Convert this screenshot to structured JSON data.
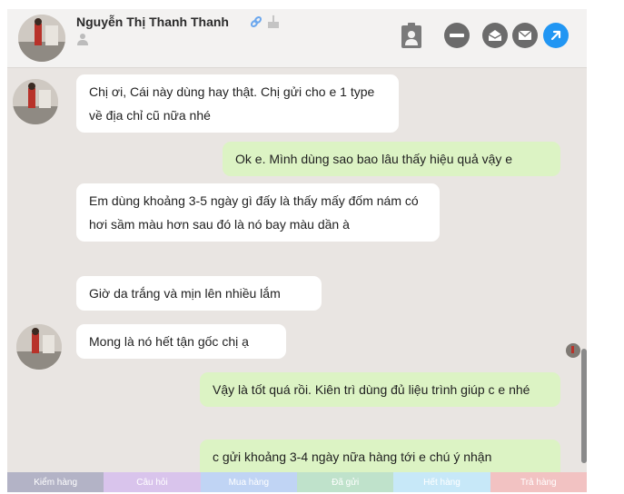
{
  "header": {
    "contact_name": "Nguyễn Thị Thanh Thanh",
    "icons": [
      "link-icon",
      "birthday-cake-icon",
      "person-icon"
    ],
    "actions": [
      "contact-card-icon",
      "minus-icon",
      "mail-open-icon",
      "mail-icon",
      "arrow-expand-icon"
    ],
    "accent_color": "#2196f3"
  },
  "messages": [
    {
      "side": "in",
      "text": "Chị ơi, Cái này dùng hay thật. Chị gửi cho e 1 type về địa chỉ cũ nữa nhé"
    },
    {
      "side": "out",
      "text": "Ok e. Mình dùng sao bao lâu thấy hiệu quả vậy e"
    },
    {
      "side": "in",
      "text": "Em dùng khoảng 3-5 ngày gì đấy là thấy mấy đốm nám có hơi sầm màu hơn sau đó là nó bay màu dần à"
    },
    {
      "side": "in",
      "text": "Giờ da trắng và mịn lên nhiều lắm"
    },
    {
      "side": "in",
      "text": "Mong là nó hết tận gốc chị ạ"
    },
    {
      "side": "out",
      "text": "Vậy là tốt quá rồi. Kiên trì dùng đủ liệu trình giúp c e nhé"
    },
    {
      "side": "out",
      "text": "c gửi khoảng 3-4 ngày nữa hàng tới e chú ý nhận"
    }
  ],
  "tags": [
    {
      "label": "Kiểm hàng",
      "color": "#b3b3c6"
    },
    {
      "label": "Câu hỏi",
      "color": "#d9c4ec"
    },
    {
      "label": "Mua hàng",
      "color": "#c0d4f4"
    },
    {
      "label": "Đã gửi",
      "color": "#bfe2cb"
    },
    {
      "label": "Hết hàng",
      "color": "#c7e8f8"
    },
    {
      "label": "Trả hàng",
      "color": "#f2c2c2"
    }
  ]
}
